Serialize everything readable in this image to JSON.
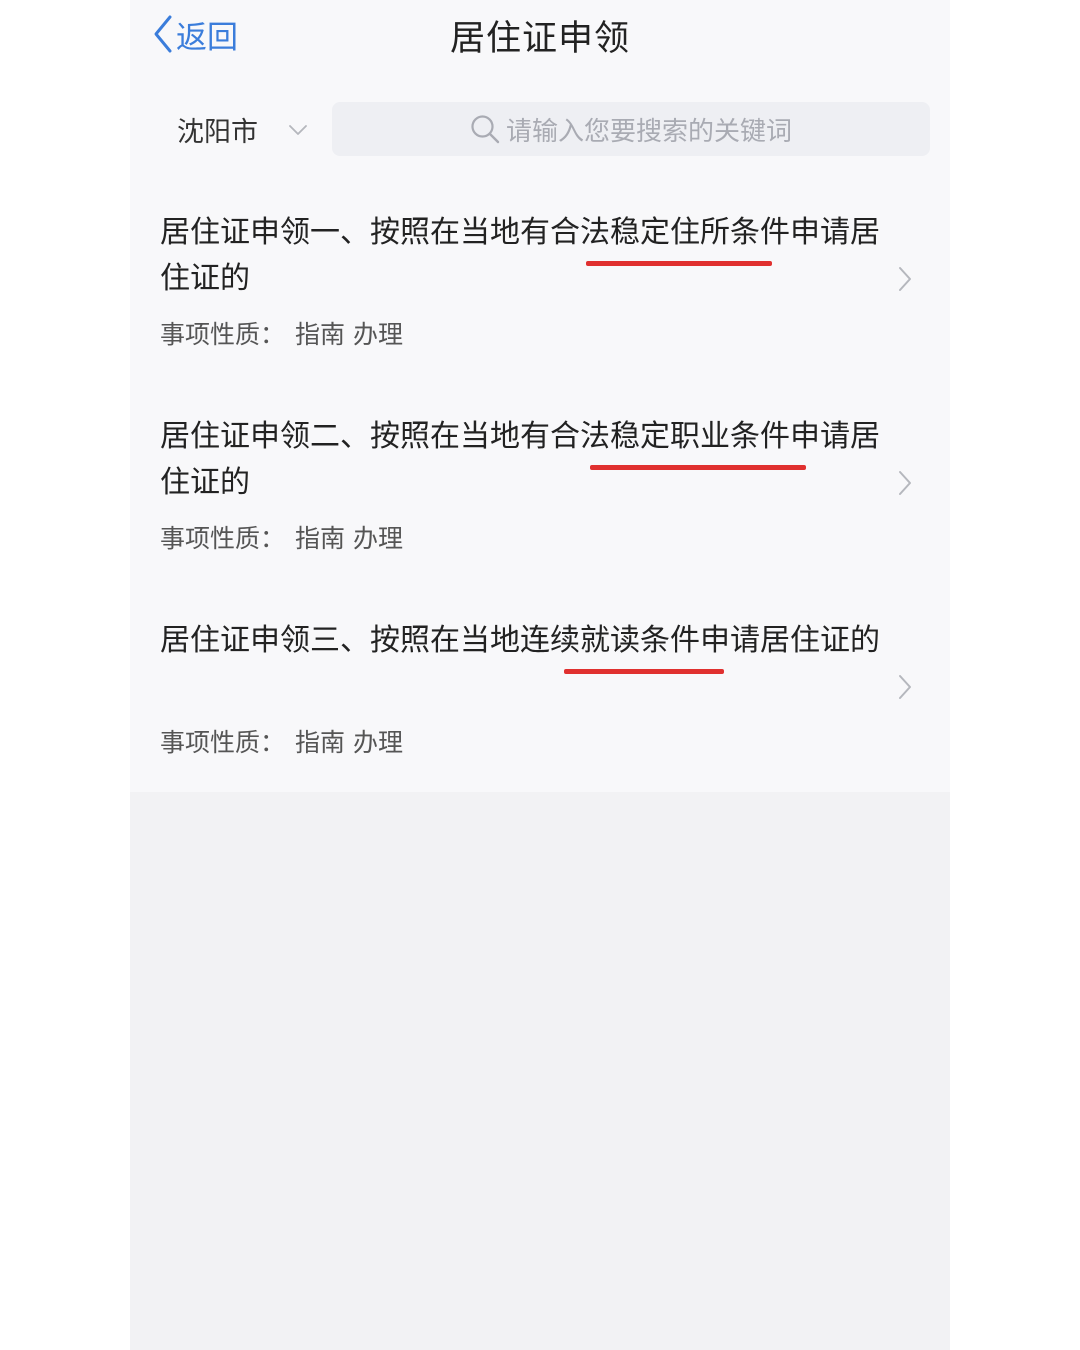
{
  "header": {
    "back_label": "返回",
    "title": "居住证申领"
  },
  "filter": {
    "city": "沈阳市",
    "search_placeholder": "请输入您要搜索的关键词"
  },
  "items": [
    {
      "title": "居住证申领一、按照在当地有合法稳定住所条件申请居住证的",
      "meta_label": "事项性质：",
      "tag1": "指南",
      "tag2": "办理"
    },
    {
      "title": "居住证申领二、按照在当地有合法稳定职业条件申请居住证的",
      "meta_label": "事项性质：",
      "tag1": "指南",
      "tag2": "办理"
    },
    {
      "title": "居住证申领三、按照在当地连续就读条件申请居住证的",
      "meta_label": "事项性质：",
      "tag1": "指南",
      "tag2": "办理"
    }
  ],
  "colors": {
    "accent": "#3b7ddb",
    "annotation_underline": "#e0302f"
  }
}
